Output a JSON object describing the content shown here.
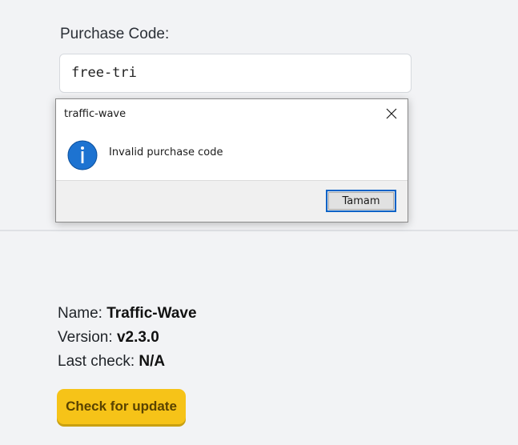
{
  "form": {
    "purchase_label": "Purchase Code:",
    "purchase_value": "free-tri"
  },
  "dialog": {
    "title": "traffic-wave",
    "message": "Invalid purchase code",
    "ok_label": "Tamam",
    "close_icon": "close-icon",
    "info_icon": "info-icon"
  },
  "about": {
    "name_label": "Name:",
    "name_value": "Traffic-Wave",
    "version_label": "Version:",
    "version_value": "v2.3.0",
    "last_check_label": "Last check:",
    "last_check_value": "N/A",
    "update_button": "Check for update"
  },
  "colors": {
    "page_bg": "#f2f3f5",
    "accent_yellow": "#f6c318",
    "info_blue": "#0a63c7"
  }
}
